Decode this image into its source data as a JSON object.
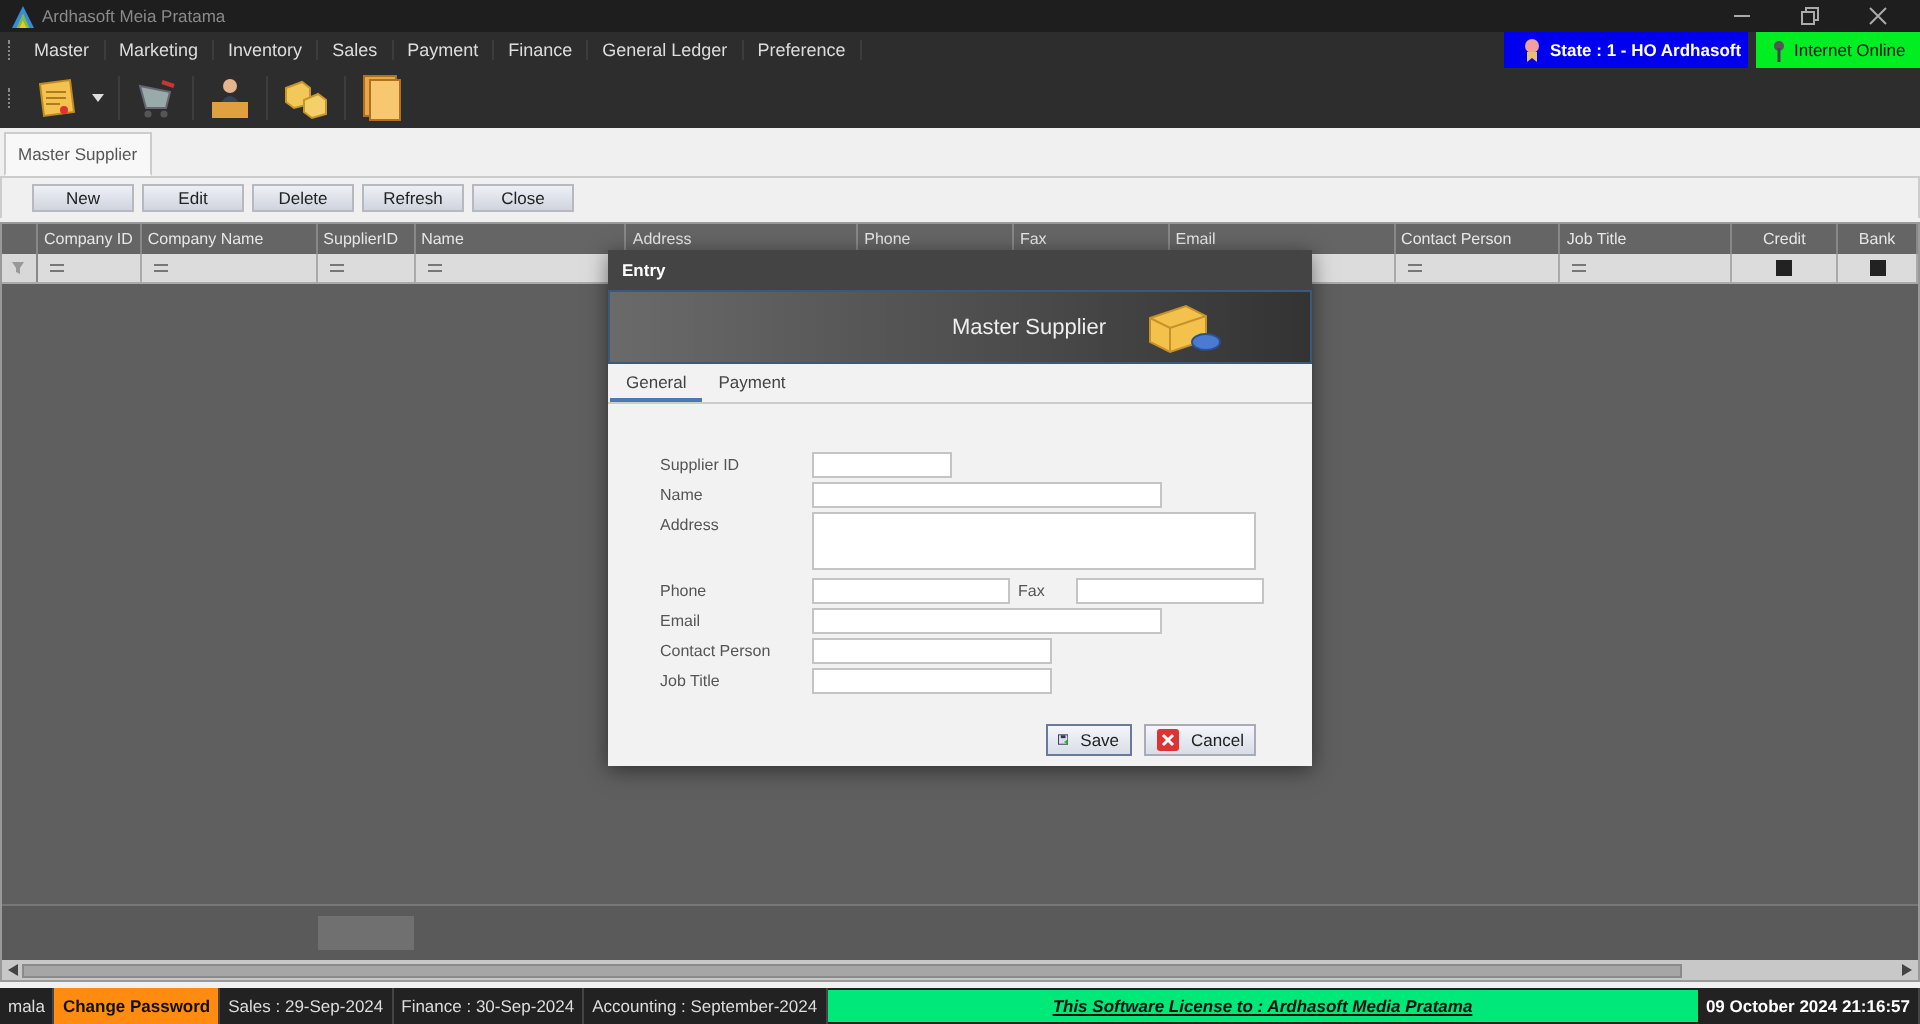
{
  "window": {
    "title": "Ardhasoft Meia Pratama"
  },
  "menu": [
    "Master",
    "Marketing",
    "Inventory",
    "Sales",
    "Payment",
    "Finance",
    "General Ledger",
    "Preference"
  ],
  "state_badge": "State : 1 - HO Ardhasoft",
  "internet_badge": "Internet Online",
  "tabs": [
    {
      "label": "Master Supplier",
      "selected": true
    }
  ],
  "buttons": [
    "New",
    "Edit",
    "Delete",
    "Refresh",
    "Close"
  ],
  "table": {
    "columns": [
      {
        "label": "Company ID",
        "kind": "text"
      },
      {
        "label": "Company Name",
        "kind": "text"
      },
      {
        "label": "SupplierID",
        "kind": "text"
      },
      {
        "label": "Name",
        "kind": "text"
      },
      {
        "label": "Address",
        "kind": "text"
      },
      {
        "label": "Phone",
        "kind": "text"
      },
      {
        "label": "Fax",
        "kind": "text"
      },
      {
        "label": "Email",
        "kind": "text"
      },
      {
        "label": "Contact Person",
        "kind": "text"
      },
      {
        "label": "Job Title",
        "kind": "text"
      },
      {
        "label": "Credit",
        "kind": "check",
        "filter_checked": true
      },
      {
        "label": "Bank",
        "kind": "check",
        "filter_checked": true
      }
    ]
  },
  "dialog": {
    "title": "Entry",
    "header": "Master Supplier",
    "tabs": [
      {
        "label": "General",
        "selected": true
      },
      {
        "label": "Payment",
        "selected": false
      }
    ],
    "fields": [
      {
        "kind": "short",
        "label": "Supplier ID"
      },
      {
        "kind": "long",
        "label": "Name"
      },
      {
        "kind": "area",
        "label": "Address"
      },
      {
        "kind": "pair",
        "label": "Phone",
        "label_2": "Fax"
      },
      {
        "kind": "long",
        "label": "Email"
      },
      {
        "kind": "medium",
        "label": "Contact Person"
      },
      {
        "kind": "medium",
        "label": "Job Title"
      }
    ],
    "buttons": [
      {
        "kind": "save",
        "label": "Save"
      },
      {
        "kind": "cancel",
        "label": "Cancel"
      }
    ]
  },
  "status_bar": {
    "user": "mala",
    "change_password": "Change Password",
    "sales": "Sales : 29-Sep-2024",
    "finance": "Finance : 30-Sep-2024",
    "accounting": "Accounting : September-2024",
    "license": "This Software License to : Ardhasoft Media Pratama",
    "datetime": "09 October 2024 21:16:57"
  }
}
